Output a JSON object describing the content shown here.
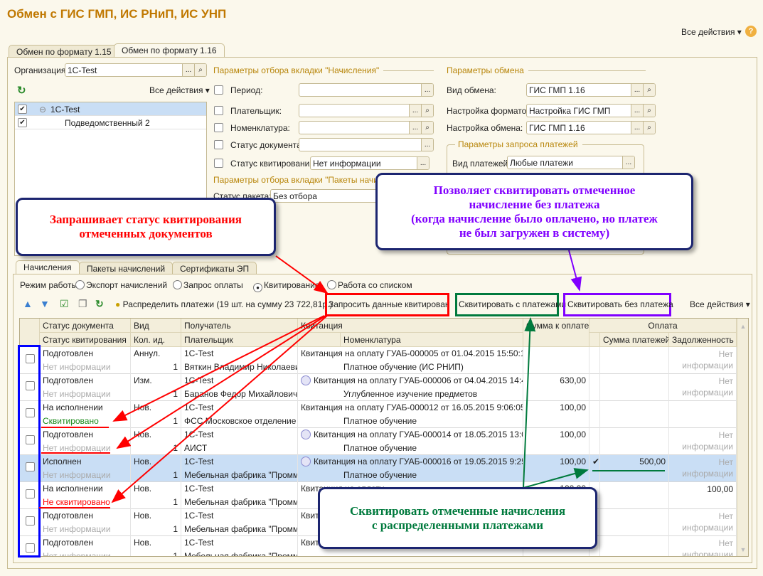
{
  "window_title": "Обмен с ГИС ГМП, ИС РНиП, ИС УНП",
  "all_actions": "Все действия ▾",
  "help_icon": "question-circle-icon",
  "tabs": [
    "Обмен по формату 1.15",
    "Обмен по формату 1.16"
  ],
  "org": {
    "label": "Организация:",
    "value": "1C-Test"
  },
  "tree": {
    "all_actions": "Все действия ▾",
    "items": [
      {
        "label": "1C-Test",
        "checked": true
      },
      {
        "label": "Подведомственный 2",
        "checked": true
      }
    ]
  },
  "filters": {
    "group": "Параметры отбора вкладки \"Начисления\"",
    "rows": [
      {
        "label": "Период:",
        "value": ""
      },
      {
        "label": "Плательщик:",
        "value": ""
      },
      {
        "label": "Номенклатура:",
        "value": ""
      },
      {
        "label": "Статус документа:",
        "value": ""
      },
      {
        "label": "Статус квитирования:",
        "value": "Нет информации"
      }
    ],
    "group2": "Параметры отбора вкладки \"Пакеты начислений\"",
    "package_status_label": "Статус пакета:",
    "package_status_value": "Без отбора"
  },
  "exchange": {
    "group": "Параметры обмена",
    "rows": [
      {
        "label": "Вид обмена:",
        "value": "ГИС ГМП 1.16"
      },
      {
        "label": "Настройка форматов:",
        "value": "Настройка ГИС ГМП"
      },
      {
        "label": "Настройка обмена:",
        "value": "ГИС ГМП 1.16"
      }
    ],
    "payments_group": "Параметры запроса платежей",
    "payments_label": "Вид платежей:",
    "payments_value": "Любые платежи"
  },
  "lower_tabs": [
    "Начисления",
    "Пакеты начислений",
    "Сертификаты ЭП"
  ],
  "mode": {
    "label": "Режим работы:",
    "options": [
      "Экспорт начислений",
      "Запрос оплаты",
      "Квитирование",
      "Работа со списком"
    ],
    "selected": "Квитирование"
  },
  "toolbar": {
    "distribute": "Распределить платежи (19 шт. на сумму 23 722,81р.)",
    "request": "Запросить данные квитирования",
    "with_payments": "Сквитировать с платежами",
    "without_payment": "Сквитировать без платежа",
    "all_actions": "Все действия ▾"
  },
  "table": {
    "headers": {
      "doc_status": "Статус документа",
      "kv_status": "Статус квитирования",
      "vid": "Вид",
      "qty": "Кол. ид.",
      "recipient": "Получатель",
      "payer": "Плательщик",
      "receipt": "Квитанция",
      "nomenclature": "Номенклатура",
      "sum": "Сумма к оплате",
      "payment": "Оплата",
      "pay_sum": "Сумма платежей",
      "debt": "Задолженность"
    },
    "rows": [
      {
        "doc": "Подготовлен",
        "kv": "Нет информации",
        "kvc": "grey",
        "vid": "Аннул.",
        "qty": "1",
        "rec": "1C-Test",
        "payer": "Вяткин Владимир Николаевич",
        "icon": false,
        "receipt": "Квитанция на оплату ГУАБ-000005 от 01.04.2015 15:50:19",
        "nom": "Платное обучение (ИС РНИП)",
        "sum": "",
        "chk": "",
        "pay": "",
        "debt": "Нет информации"
      },
      {
        "doc": "Подготовлен",
        "kv": "Нет информации",
        "kvc": "grey",
        "vid": "Изм.",
        "qty": "1",
        "rec": "1C-Test",
        "payer": "Баранов Федор Михайлович",
        "icon": true,
        "receipt": "Квитанция на оплату ГУАБ-000006 от 04.04.2015 14:47...",
        "nom": "Углубленное изучение предметов",
        "sum": "630,00",
        "chk": "",
        "pay": "",
        "debt": "Нет информации"
      },
      {
        "doc": "На исполнении",
        "kv": "Сквитировано",
        "kvc": "green",
        "vid": "Нов.",
        "qty": "1",
        "rec": "1C-Test",
        "payer": "ФСС Московское отделение",
        "icon": false,
        "receipt": "Квитанция на оплату ГУАБ-000012 от 16.05.2015 9:06:05",
        "nom": "Платное обучение",
        "sum": "100,00",
        "chk": "",
        "pay": "",
        "debt": ""
      },
      {
        "doc": "Подготовлен",
        "kv": "Нет информации",
        "kvc": "grey",
        "vid": "Нов.",
        "qty": "1",
        "rec": "1C-Test",
        "payer": "АИСТ",
        "icon": true,
        "receipt": "Квитанция на оплату ГУАБ-000014 от 18.05.2015 13:03...",
        "nom": "Платное обучение",
        "sum": "100,00",
        "chk": "",
        "pay": "",
        "debt": "Нет информации"
      },
      {
        "doc": "Исполнен",
        "kv": "Нет информации",
        "kvc": "grey",
        "vid": "Нов.",
        "qty": "1",
        "rec": "1C-Test",
        "payer": "Мебельная фабрика \"Проммебель\"",
        "icon": true,
        "receipt": "Квитанция на оплату ГУАБ-000016 от 19.05.2015 9:25:44",
        "nom": "Платное обучение",
        "sum": "100,00",
        "chk": "✔",
        "pay": "500,00",
        "debt": "Нет информации",
        "selected": true
      },
      {
        "doc": "На исполнении",
        "kv": "Не сквитировано",
        "kvc": "red",
        "vid": "Нов.",
        "qty": "1",
        "rec": "1C-Test",
        "payer": "Мебельная фабрика \"Проммебель\"",
        "icon": false,
        "receipt": "Квитанция на оплату",
        "nom": "",
        "sum": "100,00",
        "chk": "",
        "pay": "",
        "debt": "100,00"
      },
      {
        "doc": "Подготовлен",
        "kv": "Нет информации",
        "kvc": "grey",
        "vid": "Нов.",
        "qty": "1",
        "rec": "1C-Test",
        "payer": "Мебельная фабрика \"Проммебель\"",
        "icon": false,
        "receipt": "Квитанция на оплату",
        "nom": "",
        "sum": "",
        "chk": "",
        "pay": "",
        "debt": "Нет информации"
      },
      {
        "doc": "Подготовлен",
        "kv": "Нет информации",
        "kvc": "grey",
        "vid": "Нов.",
        "qty": "1",
        "rec": "1C-Test",
        "payer": "Мебельная фабрика \"Проммебель\"",
        "icon": false,
        "receipt": "Квитанция на оплату",
        "nom": "",
        "sum": "",
        "chk": "",
        "pay": "",
        "debt": "Нет информации"
      }
    ]
  },
  "callouts": {
    "request": [
      "Запрашивает статус квитирования",
      "отмеченных документов"
    ],
    "without": [
      "Позволяет сквитировать отмеченное",
      "начисление без платежа",
      "(когда начисление было оплачено, но платеж",
      "не был загружен в систему)"
    ],
    "with": [
      "Сквитировать отмеченные начисления",
      "с распределенными платежами"
    ]
  },
  "colors": {
    "title": "#c07800",
    "request": "#ff0000",
    "with": "#007a3d",
    "without": "#8000ff",
    "selection": "#0000ff",
    "row_selected": "#c9def5"
  }
}
